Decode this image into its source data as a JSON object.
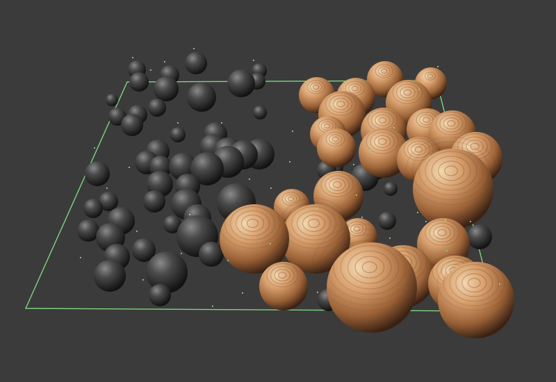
{
  "scene": {
    "background_color": "#3b3b3b",
    "bounding_box_color": "#7ed67e",
    "point_marker_color": "#8fe08f",
    "shading": {
      "dark": {
        "highlight": "#8a8a8a",
        "mid": "#3f3f3f",
        "shadow": "#121212"
      },
      "bronze": {
        "highlight": "#f4d8b0",
        "mid": "#c4895a",
        "shadow": "#3a2113",
        "ring_stroke": "#6a3f24"
      }
    }
  }
}
